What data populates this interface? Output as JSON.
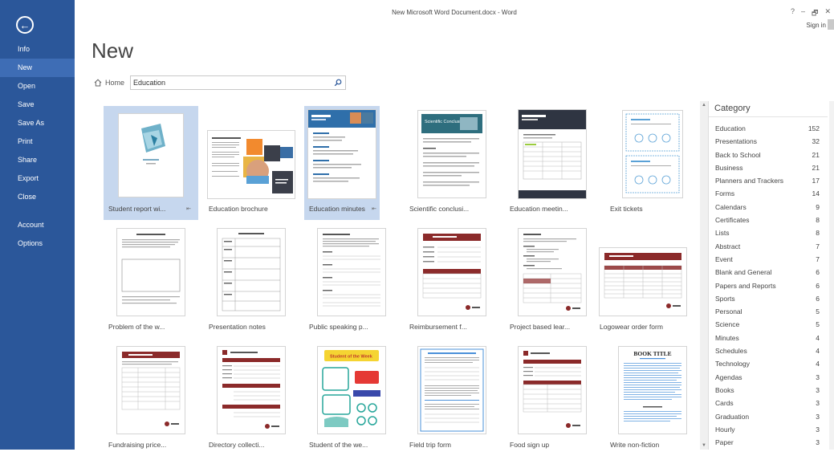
{
  "window": {
    "title": "New Microsoft Word Document.docx - Word",
    "help": "?",
    "minimize": "–",
    "restore": "🗗",
    "close": "✕",
    "sign_in": "Sign in"
  },
  "sidebar": {
    "back_icon": "back-arrow-icon",
    "items": [
      {
        "label": "Info"
      },
      {
        "label": "New"
      },
      {
        "label": "Open"
      },
      {
        "label": "Save"
      },
      {
        "label": "Save As"
      },
      {
        "label": "Print"
      },
      {
        "label": "Share"
      },
      {
        "label": "Export"
      },
      {
        "label": "Close"
      },
      {
        "label": "Account"
      },
      {
        "label": "Options"
      }
    ],
    "active": "New",
    "bg_color": "#2b579a"
  },
  "page": {
    "heading": "New",
    "home_label": "Home",
    "search_value": "Education"
  },
  "templates": [
    {
      "label": "Student report wi..."
    },
    {
      "label": "Education brochure"
    },
    {
      "label": "Education minutes"
    },
    {
      "label": "Scientific conclusi..."
    },
    {
      "label": "Education meetin..."
    },
    {
      "label": "Exit tickets"
    },
    {
      "label": "Problem of the w..."
    },
    {
      "label": "Presentation notes"
    },
    {
      "label": "Public speaking p..."
    },
    {
      "label": "Reimbursement f..."
    },
    {
      "label": "Project based lear..."
    },
    {
      "label": "Logowear order form"
    },
    {
      "label": "Fundraising price..."
    },
    {
      "label": "Directory collecti..."
    },
    {
      "label": "Student of the we..."
    },
    {
      "label": "Field trip form"
    },
    {
      "label": "Food sign up"
    },
    {
      "label": "Write non-fiction"
    }
  ],
  "thumb_text": {
    "book_title": "BOOK TITLE",
    "scientific": "Scientific Conclusion",
    "student_of_week": "Student of the Week"
  },
  "categories": {
    "title": "Category",
    "items": [
      {
        "name": "Education",
        "count": "152"
      },
      {
        "name": "Presentations",
        "count": "32"
      },
      {
        "name": "Back to School",
        "count": "21"
      },
      {
        "name": "Business",
        "count": "21"
      },
      {
        "name": "Planners and Trackers",
        "count": "17"
      },
      {
        "name": "Forms",
        "count": "14"
      },
      {
        "name": "Calendars",
        "count": "9"
      },
      {
        "name": "Certificates",
        "count": "8"
      },
      {
        "name": "Lists",
        "count": "8"
      },
      {
        "name": "Abstract",
        "count": "7"
      },
      {
        "name": "Event",
        "count": "7"
      },
      {
        "name": "Blank and General",
        "count": "6"
      },
      {
        "name": "Papers and Reports",
        "count": "6"
      },
      {
        "name": "Sports",
        "count": "6"
      },
      {
        "name": "Personal",
        "count": "5"
      },
      {
        "name": "Science",
        "count": "5"
      },
      {
        "name": "Minutes",
        "count": "4"
      },
      {
        "name": "Schedules",
        "count": "4"
      },
      {
        "name": "Technology",
        "count": "4"
      },
      {
        "name": "Agendas",
        "count": "3"
      },
      {
        "name": "Books",
        "count": "3"
      },
      {
        "name": "Cards",
        "count": "3"
      },
      {
        "name": "Graduation",
        "count": "3"
      },
      {
        "name": "Hourly",
        "count": "3"
      },
      {
        "name": "Paper",
        "count": "3"
      }
    ]
  }
}
